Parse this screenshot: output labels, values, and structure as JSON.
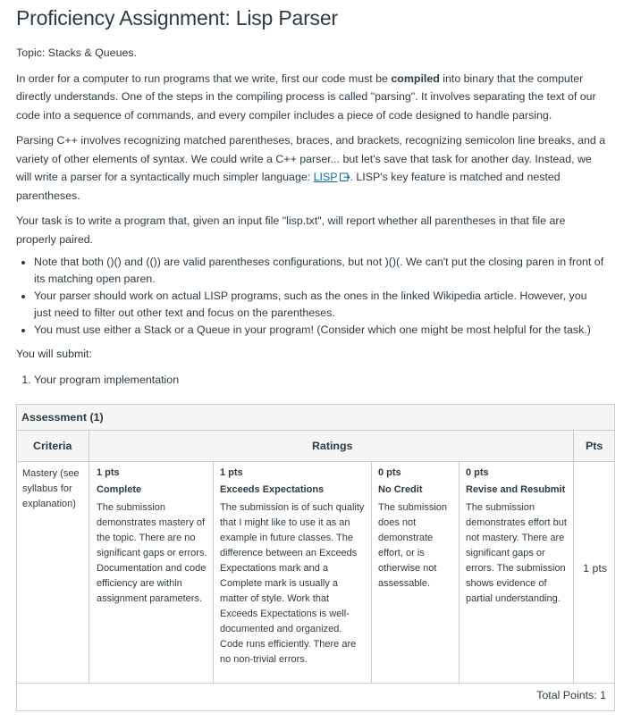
{
  "title": "Proficiency Assignment: Lisp Parser",
  "topic": "Topic: Stacks & Queues.",
  "p1": {
    "before": "In order for a computer to run programs that we write, first our code must be ",
    "bold": "compiled",
    "after": " into binary that the computer directly understands. One of the steps in the compiling process is called \"parsing\". It involves separating the text of our code into a sequence of commands, and every compiler includes a piece of code designed to handle parsing."
  },
  "p2": {
    "before": "Parsing C++ involves recognizing matched parentheses, braces, and brackets, recognizing semicolon line breaks, and a variety of other elements of syntax. We could write a C++ parser... but let's save that task for another day. Instead, we will write a parser for a syntactically much simpler language: ",
    "link": "LISP",
    "after": ". LISP's key feature is matched and nested parentheses."
  },
  "p3": "Your task is to write a program that, given an input file \"lisp.txt\", will report whether all parentheses in that file are properly paired.",
  "bullets": [
    "Note that both ()() and (()) are valid parentheses configurations, but not )()(. We can't put the closing paren in front of its matching open paren.",
    "Your parser should work on actual LISP programs, such as the ones in the linked Wikipedia article. However, you just need to filter out other text and focus on the parentheses.",
    "You must use either a Stack or a Queue in your program! (Consider which one might be most helpful for the task.)"
  ],
  "submit_intro": "You will submit:",
  "submit_items": [
    "Your program implementation"
  ],
  "rubric": {
    "title": "Assessment (1)",
    "headers": {
      "criteria": "Criteria",
      "ratings": "Ratings",
      "pts": "Pts"
    },
    "criterion": "Mastery (see syllabus for explanation)",
    "ratings": [
      {
        "pts": "1 pts",
        "label": "Complete",
        "desc": "The submission demonstrates mastery of the topic. There are no significant gaps or errors. Documentation and code efficiency are within assignment parameters."
      },
      {
        "pts": "1 pts",
        "label": "Exceeds Expectations",
        "desc": "The submission is of such quality that I might like to use it as an example in future classes. The difference between an Exceeds Expectations mark and a Complete mark is usually a matter of style. Work that Exceeds Expectations is well-documented and organized. Code runs efficiently. There are no non-trivial errors."
      },
      {
        "pts": "0 pts",
        "label": "No Credit",
        "desc": "The submission does not demonstrate effort, or is otherwise not assessable."
      },
      {
        "pts": "0 pts",
        "label": "Revise and Resubmit",
        "desc": "The submission demonstrates effort but not mastery. There are significant gaps or errors. The submission shows evidence of partial understanding."
      }
    ],
    "criterion_pts": "1 pts",
    "total": "Total Points: 1"
  },
  "colors": {
    "link": "#0770a3",
    "text": "#2d3b45",
    "border": "#c7cdd1",
    "header_bg": "#f5f5f5"
  },
  "icons": {
    "external_link": "external-link-icon"
  }
}
